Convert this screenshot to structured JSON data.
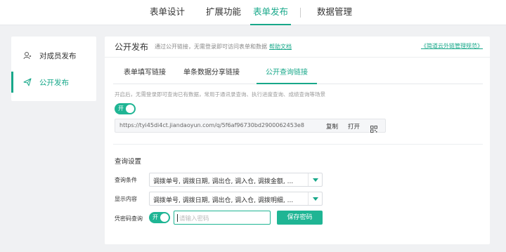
{
  "colors": {
    "accent": "#18a88a",
    "toggle": "#1fb594"
  },
  "topnav": {
    "tabs": [
      {
        "label": "表单设计",
        "active": false
      },
      {
        "label": "扩展功能",
        "active": false
      },
      {
        "label": "表单发布",
        "active": true
      },
      {
        "label": "数据管理",
        "active": false
      }
    ]
  },
  "sidebar": {
    "items": [
      {
        "label": "对成员发布",
        "icon": "user-icon",
        "active": false
      },
      {
        "label": "公开发布",
        "icon": "send-icon",
        "active": true
      }
    ]
  },
  "main": {
    "title": "公开发布",
    "description": "通过公开链接，无需登录即可访问表单和数据",
    "help_link": "帮助文档",
    "external_link": "《简道云外链管理规范》",
    "subtabs": [
      {
        "label": "表单填写链接",
        "active": false
      },
      {
        "label": "单条数据分享链接",
        "active": false
      },
      {
        "label": "公开查询链接",
        "active": true
      }
    ],
    "hint": "开启后，无需登录即可查询已有数据，常用于通讯录查询、执行进度查询、成绩查询等场景",
    "public_toggle": {
      "label": "开",
      "on": true
    },
    "url": "https://tyi45di4ct.jiandaoyun.com/q/5f6af96730bd2900062453e8",
    "url_actions": {
      "copy": "复制",
      "open": "打开"
    },
    "query_settings": {
      "title": "查询设置",
      "condition_label": "查询条件",
      "condition_value": "调拨单号, 调拨日期, 调出仓, 调入仓, 调拨金额, ...",
      "display_label": "显示内容",
      "display_value": "调拨单号, 调拨日期, 调出仓, 调入仓, 调拨明细, ...",
      "password_label": "凭密码查询",
      "password_toggle": {
        "label": "开",
        "on": true
      },
      "password_placeholder": "请输入密码",
      "save_button": "保存密码"
    }
  }
}
